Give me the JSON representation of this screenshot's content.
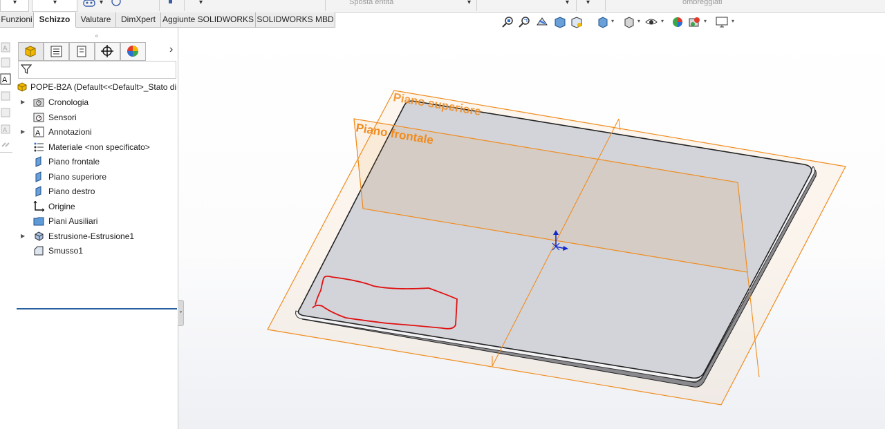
{
  "toolbar_top": {
    "move_entities_label": "Sposta entità",
    "shaded_label": "ombreggiati"
  },
  "tabs": [
    {
      "label": "Funzioni",
      "active": false
    },
    {
      "label": "Schizzo",
      "active": true
    },
    {
      "label": "Valutare",
      "active": false
    },
    {
      "label": "DimXpert",
      "active": false
    },
    {
      "label": "Aggiunte SOLIDWORKS",
      "active": false
    },
    {
      "label": "SOLIDWORKS MBD",
      "active": false
    }
  ],
  "feature_tree": {
    "root_label": "POPE-B2A  (Default<<Default>_Stato di",
    "items": [
      {
        "label": "Cronologia",
        "icon": "history-folder-icon",
        "expandable": true
      },
      {
        "label": "Sensori",
        "icon": "sensor-icon",
        "expandable": false
      },
      {
        "label": "Annotazioni",
        "icon": "annotation-icon",
        "expandable": true
      },
      {
        "label": "Materiale <non specificato>",
        "icon": "material-icon",
        "expandable": false
      },
      {
        "label": "Piano frontale",
        "icon": "plane-icon",
        "expandable": false
      },
      {
        "label": "Piano superiore",
        "icon": "plane-icon",
        "expandable": false
      },
      {
        "label": "Piano destro",
        "icon": "plane-icon",
        "expandable": false
      },
      {
        "label": "Origine",
        "icon": "origin-icon",
        "expandable": false
      },
      {
        "label": "Piani Ausiliari",
        "icon": "folder-icon",
        "expandable": false
      },
      {
        "label": "Estrusione-Estrusione1",
        "icon": "extrude-icon",
        "expandable": true
      },
      {
        "label": "Smusso1",
        "icon": "chamfer-icon",
        "expandable": false
      }
    ]
  },
  "viewport": {
    "plane_labels": {
      "top": "Piano superiore",
      "front": "Piano frontale"
    },
    "colors": {
      "plane": "#f08c1e",
      "part": "#cfd0d6",
      "annotation": "#e01010",
      "origin": "#1028c8"
    }
  }
}
